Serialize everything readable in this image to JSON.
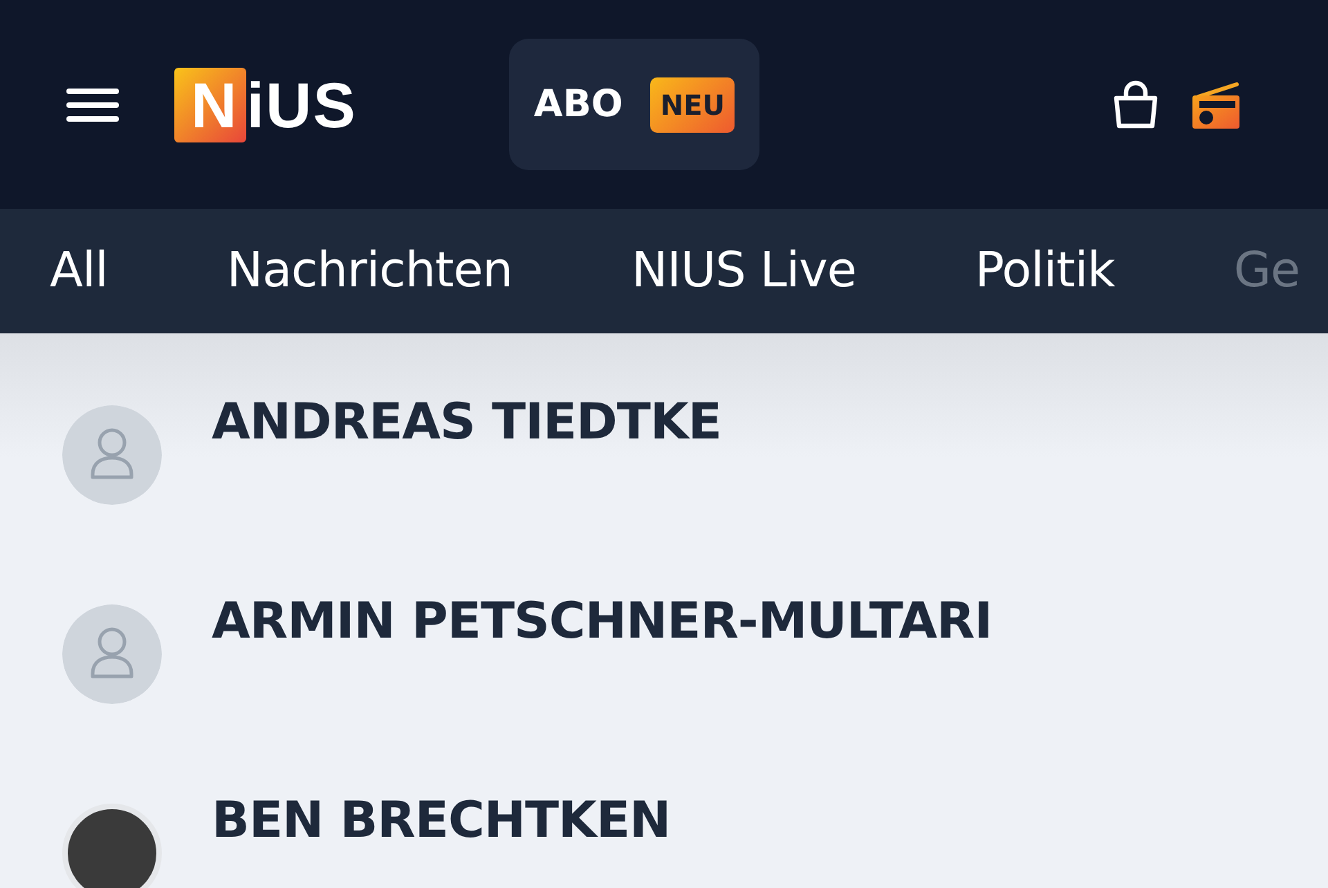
{
  "header": {
    "logo": {
      "boxed": "N",
      "rest": "iUS"
    },
    "abo_button": {
      "label": "ABO",
      "badge": "NEU"
    }
  },
  "categories": [
    {
      "label": "All",
      "faded": false
    },
    {
      "label": "Nachrichten",
      "faded": false
    },
    {
      "label": "NIUS Live",
      "faded": false
    },
    {
      "label": "Politik",
      "faded": false
    },
    {
      "label": "Ge",
      "faded": true
    }
  ],
  "authors": [
    {
      "name": "ANDREAS TIEDTKE",
      "kind": "placeholder"
    },
    {
      "name": "ARMIN PETSCHNER-MULTARI",
      "kind": "placeholder"
    },
    {
      "name": "BEN BRECHTKEN",
      "kind": "photo"
    }
  ]
}
